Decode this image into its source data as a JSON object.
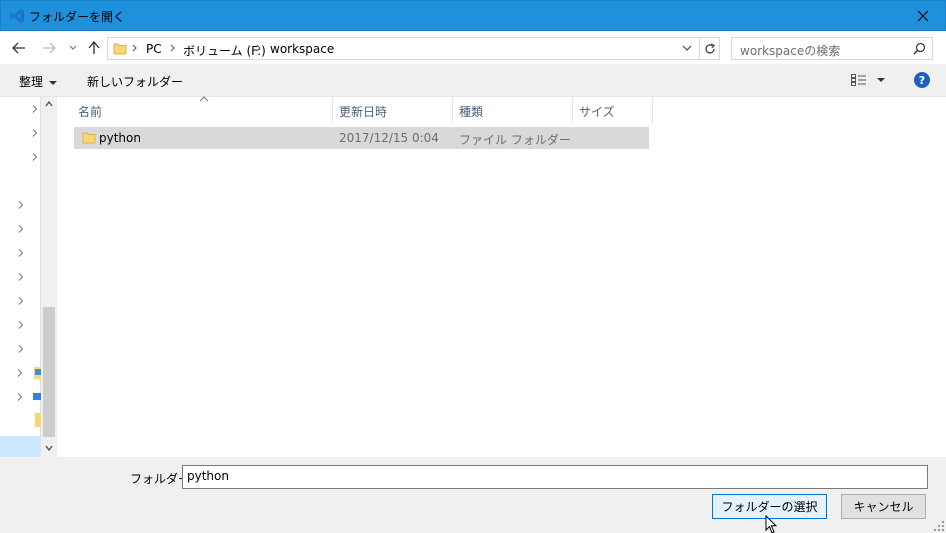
{
  "window": {
    "title": "フォルダーを開く",
    "close_glyph": "✕"
  },
  "address": {
    "crumbs": [
      "PC",
      "ボリューム (F:)",
      "workspace"
    ],
    "search_placeholder": "workspaceの検索"
  },
  "toolbar": {
    "organize_label": "整理",
    "new_folder_label": "新しいフォルダー",
    "help_label": "?"
  },
  "columns": {
    "name": "名前",
    "date": "更新日時",
    "type": "種類",
    "size": "サイズ"
  },
  "files": [
    {
      "name": "python",
      "date": "2017/12/15 0:04",
      "type": "ファイル フォルダー",
      "size": ""
    }
  ],
  "footer": {
    "folder_label": "フォルダー:",
    "folder_value": "python",
    "select_button": "フォルダーの選択",
    "cancel_button": "キャンセル"
  },
  "colors": {
    "titlebar": "#1e90dc",
    "selection": "#cce8ff",
    "row_selected": "#d9d9d9",
    "primary_border": "#0078d7"
  }
}
